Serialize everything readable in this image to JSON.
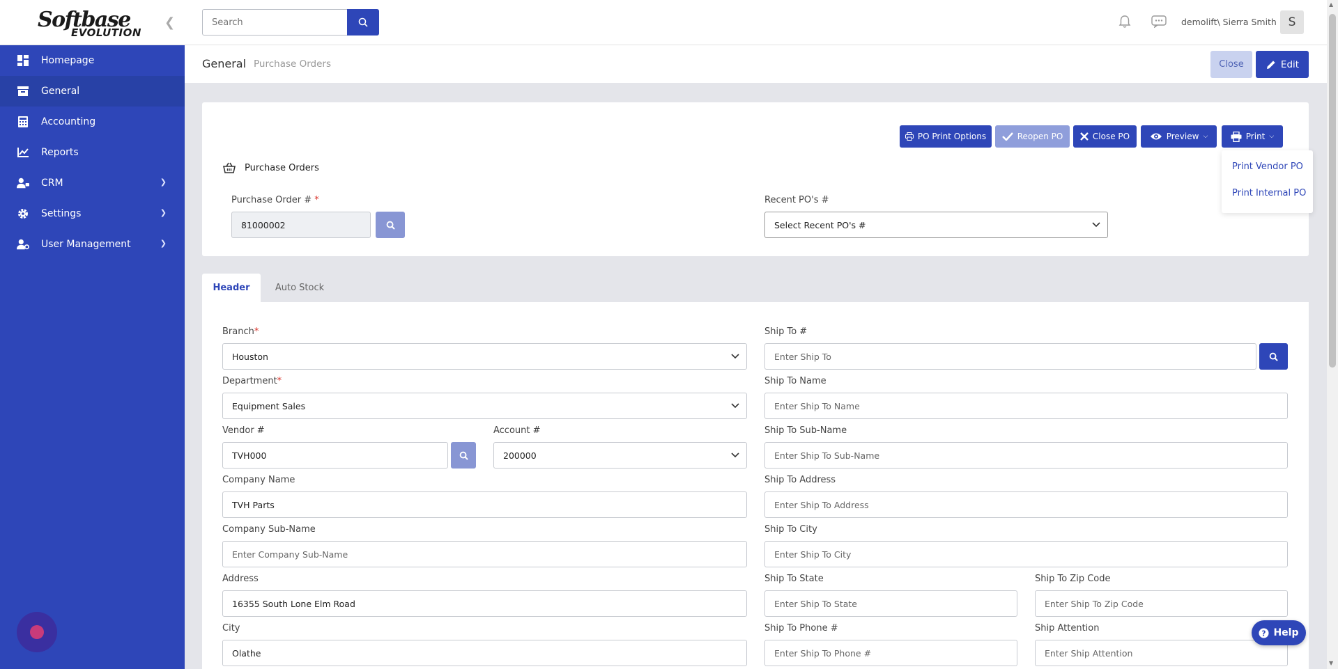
{
  "app": {
    "logo_line1": "Softbase",
    "logo_line2": "EVOLUTION"
  },
  "sidebar": {
    "items": [
      {
        "label": "Homepage"
      },
      {
        "label": "General"
      },
      {
        "label": "Accounting"
      },
      {
        "label": "Reports"
      },
      {
        "label": "CRM"
      },
      {
        "label": "Settings"
      },
      {
        "label": "User Management"
      }
    ]
  },
  "topbar": {
    "search_placeholder": "Search",
    "username": "demolift\\ Sierra Smith",
    "avatar_initial": "S"
  },
  "breadcrumb": {
    "section": "General",
    "page": "Purchase Orders"
  },
  "actions": {
    "close": "Close",
    "edit": "Edit"
  },
  "po_panel": {
    "title": "Purchase Orders",
    "buttons": {
      "print_options": "PO Print Options",
      "reopen": "Reopen PO",
      "close_po": "Close PO",
      "preview": "Preview",
      "print": "Print"
    },
    "print_menu": [
      "Print Vendor PO",
      "Print Internal PO"
    ],
    "po_number_label": "Purchase Order #",
    "po_number_value": "81000002",
    "recent_label": "Recent PO's #",
    "recent_placeholder": "Select Recent PO's #"
  },
  "tabs": [
    "Header",
    "Auto Stock"
  ],
  "form": {
    "branch": {
      "label": "Branch",
      "value": "Houston"
    },
    "department": {
      "label": "Department",
      "value": "Equipment Sales"
    },
    "vendor": {
      "label": "Vendor #",
      "value": "TVH000"
    },
    "account": {
      "label": "Account #",
      "value": "200000"
    },
    "company_name": {
      "label": "Company Name",
      "value": "TVH Parts"
    },
    "company_sub": {
      "label": "Company Sub-Name",
      "placeholder": "Enter Company Sub-Name"
    },
    "address": {
      "label": "Address",
      "value": "16355 South Lone Elm Road"
    },
    "city": {
      "label": "City",
      "value": "Olathe"
    },
    "ship_to": {
      "label": "Ship To #",
      "placeholder": "Enter Ship To"
    },
    "ship_name": {
      "label": "Ship To Name",
      "placeholder": "Enter Ship To Name"
    },
    "ship_sub": {
      "label": "Ship To Sub-Name",
      "placeholder": "Enter Ship To Sub-Name"
    },
    "ship_address": {
      "label": "Ship To Address",
      "placeholder": "Enter Ship To Address"
    },
    "ship_city": {
      "label": "Ship To City",
      "placeholder": "Enter Ship To City"
    },
    "ship_state": {
      "label": "Ship To State",
      "placeholder": "Enter Ship To State"
    },
    "ship_zip": {
      "label": "Ship To Zip Code",
      "placeholder": "Enter Ship To Zip Code"
    },
    "ship_phone": {
      "label": "Ship To Phone #",
      "placeholder": "Enter Ship To Phone #"
    },
    "ship_attention": {
      "label": "Ship Attention",
      "placeholder": "Enter Ship Attention"
    }
  },
  "help": {
    "label": "Help"
  },
  "colors": {
    "primary": "#2e46b8",
    "sidebar": "#2e46b8",
    "required": "#d9342b"
  }
}
